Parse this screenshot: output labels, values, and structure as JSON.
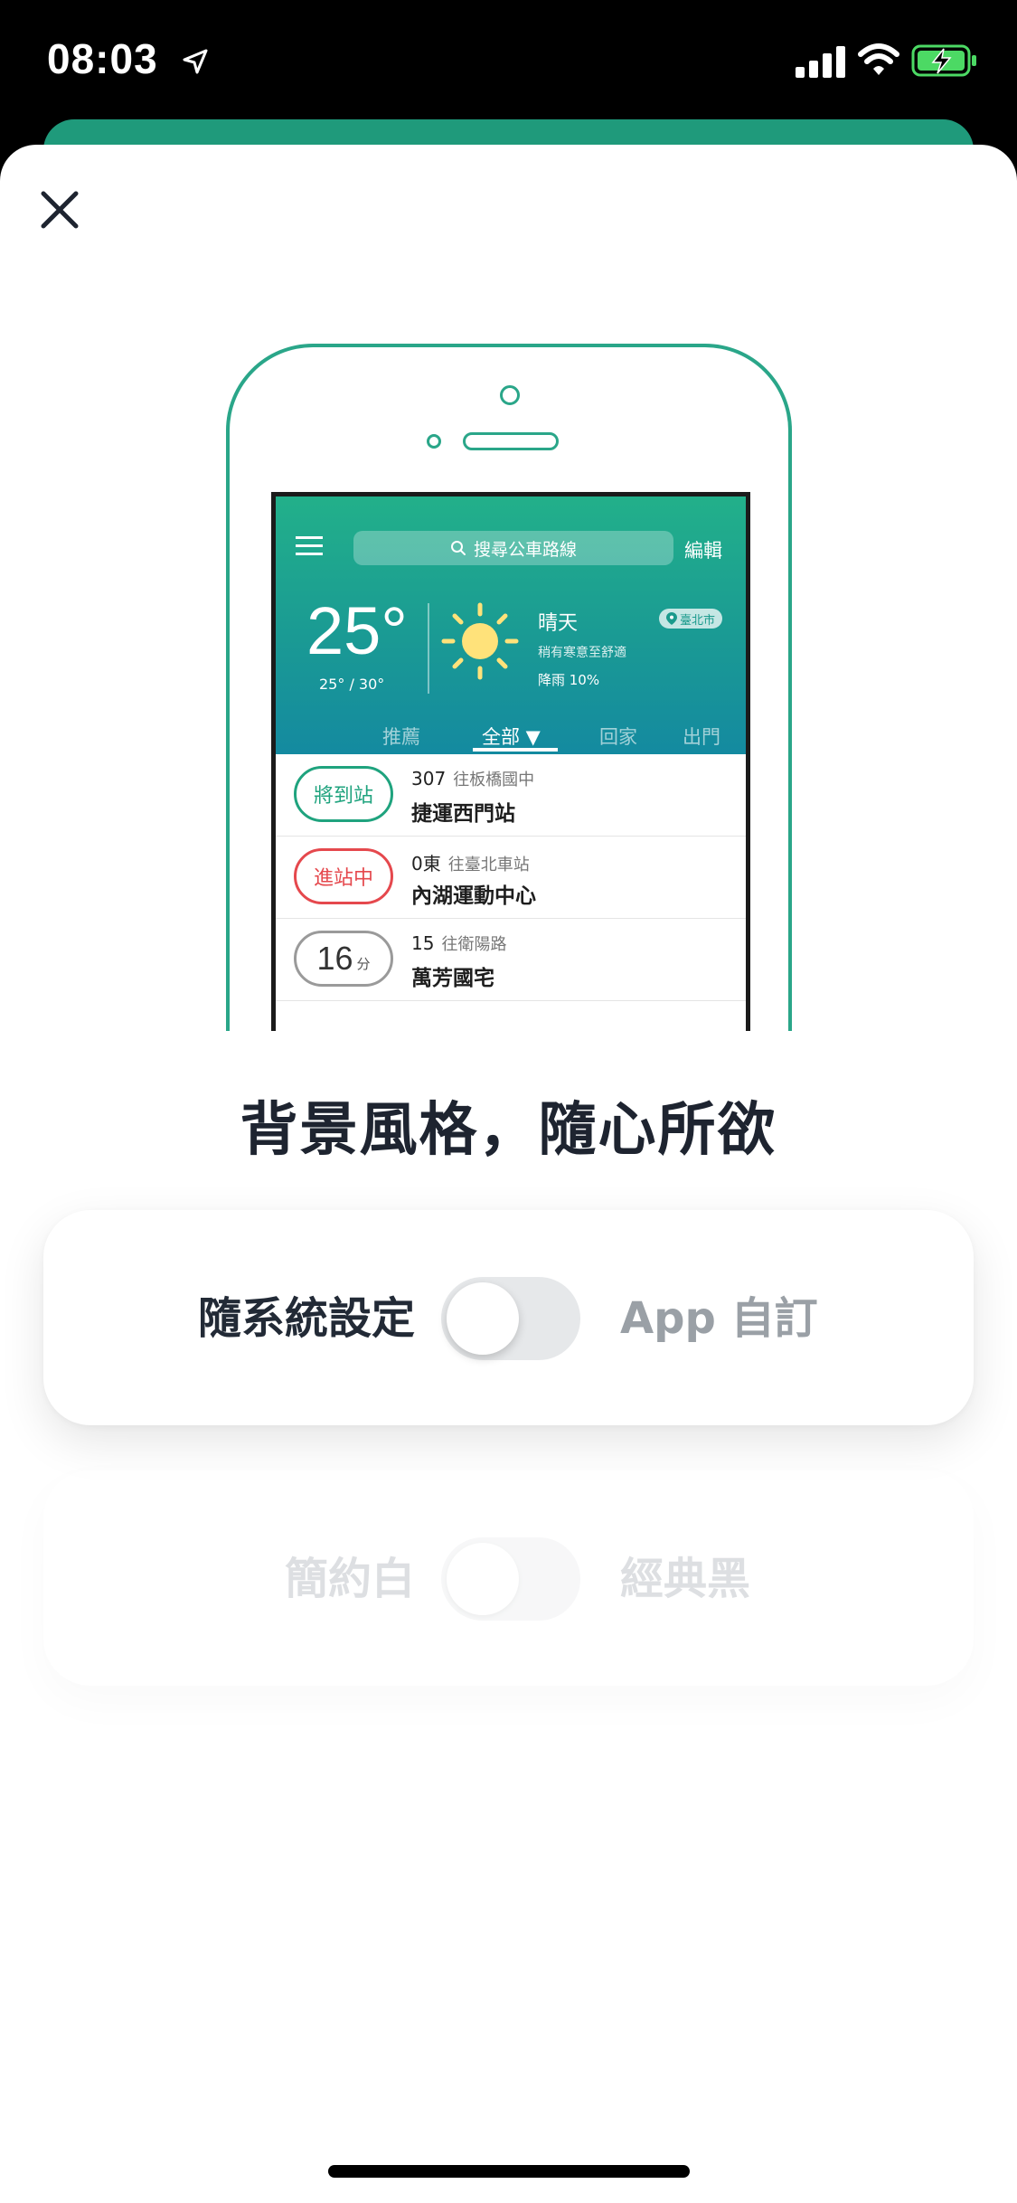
{
  "status_bar": {
    "time": "08:03"
  },
  "sheet": {
    "illustration": {
      "search_placeholder": "搜尋公車路線",
      "edit_label": "編輯",
      "temperature": "25°",
      "temp_range": "25° / 30°",
      "condition": "晴天",
      "comfort": "稍有寒意至舒適",
      "rain_chance": "降雨 10%",
      "city": "臺北市",
      "tabs": [
        "推薦",
        "全部 ▼",
        "回家",
        "出門"
      ],
      "rows": [
        {
          "badge": "將到站",
          "route": "307",
          "direction": "往板橋國中",
          "stop": "捷運西門站",
          "color": "#1fa37e"
        },
        {
          "badge": "進站中",
          "route": "0東",
          "direction": "往臺北車站",
          "stop": "內湖運動中心",
          "color": "#e5484d"
        },
        {
          "eta_value": "16",
          "eta_unit": "分",
          "route": "15",
          "direction": "往衛陽路",
          "stop": "萬芳國宅",
          "color": "#9a9a9a"
        }
      ]
    },
    "headline": "背景風格，隨心所欲",
    "toggle_cards": [
      {
        "left_label": "隨系統設定",
        "right_label": "App 自訂",
        "enabled": true,
        "on": false
      },
      {
        "left_label": "簡約白",
        "right_label": "經典黑",
        "enabled": false,
        "on": false
      }
    ]
  },
  "colors": {
    "brand_green": "#1f9a7b",
    "arriving_green": "#1fa37e",
    "entering_red": "#e5484d",
    "title_dark": "#1e2430",
    "muted_gray": "#9aa0a6"
  },
  "icons": [
    "location-arrow-icon",
    "cellular-signal-icon",
    "wifi-icon",
    "battery-charging-icon",
    "close-icon",
    "hamburger-menu-icon",
    "search-icon",
    "sun-icon",
    "map-pin-icon"
  ]
}
